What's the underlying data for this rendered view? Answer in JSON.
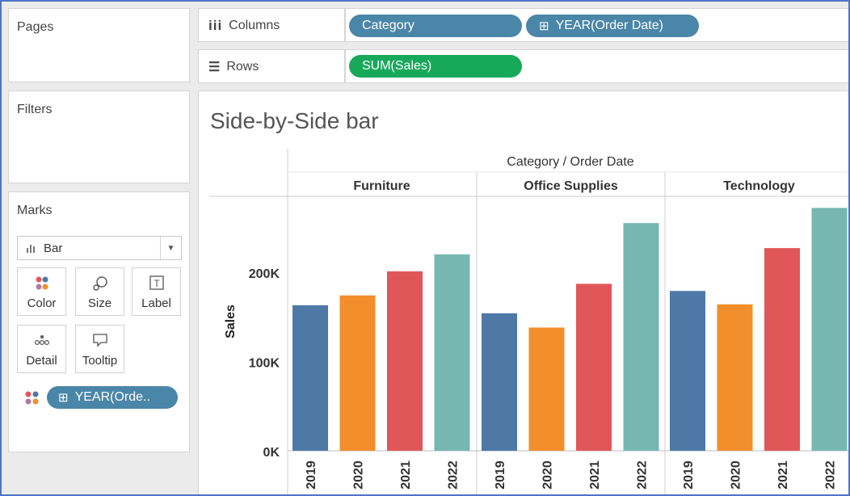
{
  "panels": {
    "pages_label": "Pages",
    "filters_label": "Filters",
    "marks_label": "Marks"
  },
  "shelves": {
    "columns_label": "Columns",
    "rows_label": "Rows",
    "columns_pills": [
      "Category",
      "YEAR(Order Date)"
    ],
    "rows_pills": [
      "SUM(Sales)"
    ]
  },
  "marks": {
    "mark_type": "Bar",
    "buttons": [
      "Color",
      "Size",
      "Label",
      "Detail",
      "Tooltip"
    ],
    "color_pill": "YEAR(Orde.."
  },
  "colors": {
    "pill_blue": "#4a86a8",
    "pill_green": "#18a85a",
    "series": [
      "#4e79a7",
      "#f28e2b",
      "#e15759",
      "#76b7b2"
    ]
  },
  "chart_data": {
    "type": "bar",
    "title": "Side-by-Side bar",
    "header": "Category / Order Date",
    "ylabel": "Sales",
    "ylim": [
      0,
      285000
    ],
    "yticks": [
      0,
      100000,
      200000
    ],
    "ytick_labels": [
      "0K",
      "100K",
      "200K"
    ],
    "panes": [
      {
        "category": "Furniture",
        "years": [
          "2019",
          "2020",
          "2021",
          "2022"
        ],
        "values": [
          163000,
          174000,
          201000,
          220000
        ]
      },
      {
        "category": "Office Supplies",
        "years": [
          "2019",
          "2020",
          "2021",
          "2022"
        ],
        "values": [
          154000,
          138000,
          187000,
          255000
        ]
      },
      {
        "category": "Technology",
        "years": [
          "2019",
          "2020",
          "2021",
          "2022"
        ],
        "values": [
          179000,
          164000,
          227000,
          272000
        ]
      }
    ]
  }
}
